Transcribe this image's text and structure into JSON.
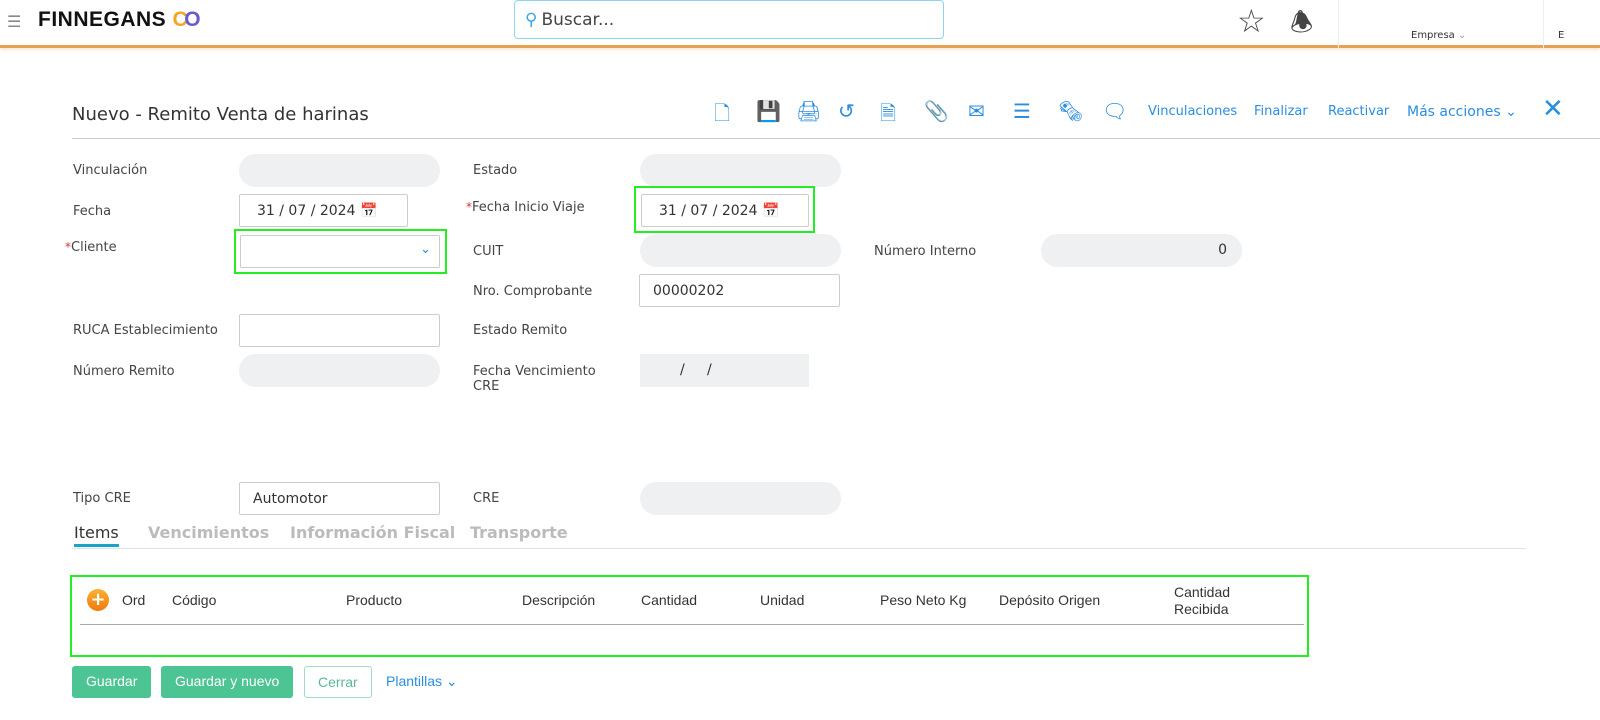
{
  "header": {
    "logo": "FINNEGANS",
    "logo_mark": "CO",
    "search_placeholder": "Buscar...",
    "empresa_label": "Empresa",
    "next_label": "E"
  },
  "page": {
    "title": "Nuevo - Remito Venta de harinas"
  },
  "toolbar": {
    "links": [
      "Vinculaciones",
      "Finalizar",
      "Reactivar",
      "Más acciones"
    ]
  },
  "form": {
    "vinculacion": {
      "label": "Vinculación",
      "value": ""
    },
    "estado": {
      "label": "Estado",
      "value": ""
    },
    "fecha": {
      "label": "Fecha",
      "value": "31 / 07 / 2024"
    },
    "fecha_inicio_viaje": {
      "label": "Fecha Inicio Viaje",
      "value": "31 / 07 / 2024"
    },
    "cliente": {
      "label": "Cliente",
      "value": ""
    },
    "cuit": {
      "label": "CUIT",
      "value": ""
    },
    "numero_interno": {
      "label": "Número Interno",
      "value": "0"
    },
    "nro_comprobante": {
      "label": "Nro. Comprobante",
      "value": "00000202"
    },
    "ruca": {
      "label": "RUCA Establecimiento",
      "value": ""
    },
    "estado_remito": {
      "label": "Estado Remito"
    },
    "numero_remito": {
      "label": "Número Remito",
      "value": ""
    },
    "fecha_venc_cre": {
      "label": "Fecha Vencimiento CRE",
      "value": "/     /"
    },
    "tipo_cre": {
      "label": "Tipo CRE",
      "value": "Automotor"
    },
    "cre": {
      "label": "CRE",
      "value": ""
    }
  },
  "tabs": [
    "Items",
    "Vencimientos",
    "Información Fiscal",
    "Transporte"
  ],
  "table": {
    "columns": [
      "Ord",
      "Código",
      "Producto",
      "Descripción",
      "Cantidad",
      "Unidad",
      "Peso Neto Kg",
      "Depósito Origen",
      "Cantidad Recibida"
    ]
  },
  "footer": {
    "guardar": "Guardar",
    "guardar_nuevo": "Guardar y nuevo",
    "cerrar": "Cerrar",
    "plantillas": "Plantillas"
  }
}
